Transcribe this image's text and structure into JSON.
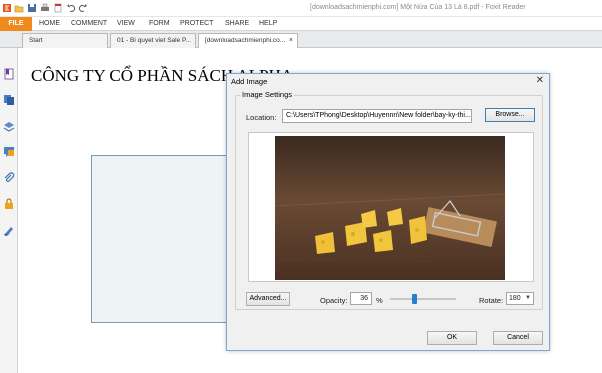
{
  "window": {
    "title": "[downloadsachmienphi.com] Một Nửa Của 13 Là 8.pdf - Foxit Reader"
  },
  "ribbon": {
    "file_label": "FILE",
    "tabs": [
      "HOME",
      "COMMENT",
      "VIEW",
      "FORM",
      "PROTECT",
      "SHARE",
      "HELP"
    ]
  },
  "doc_tabs": [
    {
      "label": "Start"
    },
    {
      "label": "01 - Bi quyet viet Sale P..."
    },
    {
      "label": "[downloadsachmienphi.co...",
      "active": true,
      "close": "×"
    }
  ],
  "document": {
    "heading": "CÔNG TY CỔ PHẦN SÁCH ALPHA"
  },
  "dialog": {
    "title": "Add Image",
    "close": "✕",
    "group_label": "Image Settings",
    "location_label": "Location:",
    "location_value": "C:\\Users\\TPhong\\Desktop\\Huyennn\\New folder\\bay-ky-thi...",
    "browse_label": "Browse...",
    "advanced_label": "Advanced...",
    "opacity_label": "Opacity:",
    "opacity_value": "36",
    "opacity_unit": "%",
    "opacity_fraction": 0.36,
    "rotate_label": "Rotate:",
    "rotate_value": "180",
    "ok_label": "OK",
    "cancel_label": "Cancel"
  },
  "icons": {
    "qat": [
      "open-file-icon",
      "save-icon",
      "print-icon",
      "new-document-icon",
      "undo-icon",
      "redo-icon"
    ],
    "leftbar": [
      "bookmark-icon",
      "pages-icon",
      "layers-icon",
      "comments-icon",
      "attachments-icon",
      "security-icon",
      "signature-icon"
    ]
  },
  "colors": {
    "file_tab": "#f08a1c",
    "dialog_border": "#7aa7d6",
    "slider_thumb": "#2a7fd2"
  }
}
